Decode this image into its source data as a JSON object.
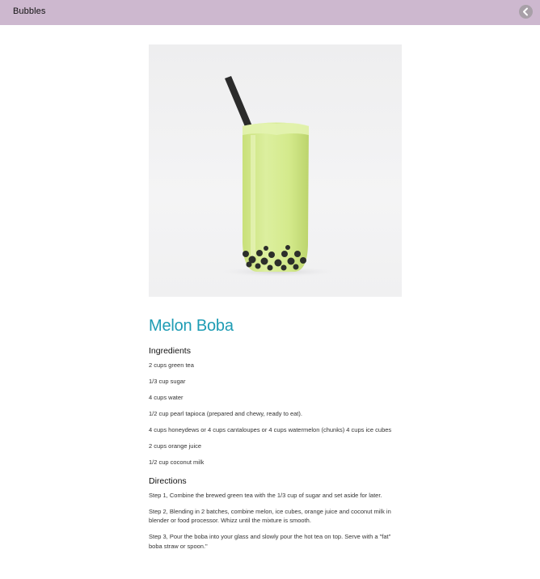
{
  "header": {
    "title": "Bubbles",
    "back_icon": "chevron-left-icon"
  },
  "hero": {
    "image": "bubble-tea-glass-photo"
  },
  "recipe": {
    "title": "Melon Boba",
    "ingredients_heading": "Ingredients",
    "ingredients": [
      "2 cups green tea",
      "1/3 cup sugar",
      "4 cups water",
      "1/2 cup pearl tapioca (prepared and chewy, ready to eat).",
      "4 cups honeydews or 4 cups cantaloupes or 4 cups watermelon (chunks) 4 cups ice cubes",
      "2 cups orange juice",
      "1/2 cup coconut milk"
    ],
    "directions_heading": "Directions",
    "directions": [
      "Step 1, Combine the brewed green tea with the 1/3 cup of sugar and set aside for later.",
      "Step 2, Blending in 2 batches, combine melon, ice cubes, orange juice and coconut milk in blender or food processor. Whizz until the mixture is smooth.",
      "Step 3, Pour the boba into your glass and slowly pour the hot tea on top. Serve with a \"fat\" boba straw or spoon.\""
    ]
  },
  "colors": {
    "header_bg": "#cdb8cf",
    "title_accent": "#1e9cb4",
    "drink": "#d9ec9a"
  }
}
